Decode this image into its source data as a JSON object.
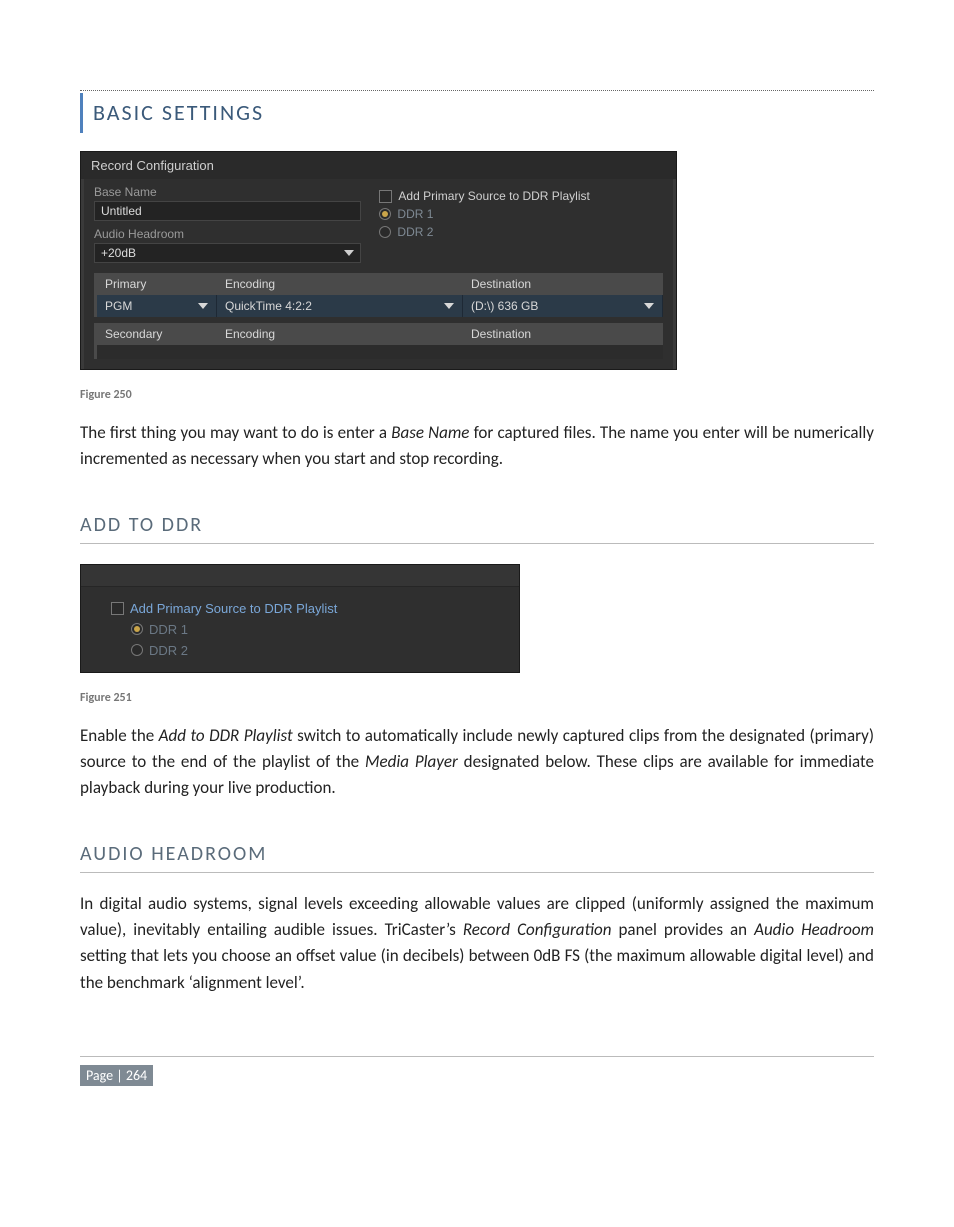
{
  "section_title": "BASIC SETTINGS",
  "fig250_caption": "Figure 250",
  "para1_a": "The first thing you may want to do is enter a ",
  "para1_em1": "Base Name",
  "para1_b": " for captured files.  The name you enter will be numerically incremented as necessary when you start and stop recording.",
  "h2_addtoddr": "ADD TO DDR",
  "fig251_caption": "Figure 251",
  "para2_a": "Enable the ",
  "para2_em1": "Add to DDR Playlist",
  "para2_b": " switch to automatically include newly captured clips from the designated (primary) source to the end of the playlist of the ",
  "para2_em2": "Media Player",
  "para2_c": " designated below. These clips are available for immediate playback during your live production.",
  "h2_audio": "AUDIO HEADROOM",
  "para3_a": "In digital audio systems, signal levels exceeding allowable values are clipped (uniformly assigned the maximum value), inevitably entailing audible issues. TriCaster’s ",
  "para3_em1": "Record Configuration",
  "para3_b": " panel provides an ",
  "para3_em2": "Audio Headroom",
  "para3_c": " setting that lets you choose an offset value (in decibels) between 0dB FS (the maximum allowable digital level) and the benchmark ‘alignment level’.",
  "page_footer": "Page | 264",
  "panel250": {
    "title": "Record Configuration",
    "base_name_label": "Base Name",
    "base_name_value": "Untitled",
    "audio_headroom_label": "Audio Headroom",
    "audio_headroom_value": "+20dB",
    "add_primary_label": "Add Primary Source to DDR Playlist",
    "ddr1_label": "DDR 1",
    "ddr2_label": "DDR 2",
    "col_primary": "Primary",
    "col_encoding": "Encoding",
    "col_destination": "Destination",
    "primary_source": "PGM",
    "primary_encoding": "QuickTime 4:2:2",
    "primary_destination": "(D:\\) 636 GB",
    "col2_secondary": "Secondary"
  },
  "panel251": {
    "add_primary_label": "Add Primary Source to DDR Playlist",
    "ddr1_label": "DDR 1",
    "ddr2_label": "DDR 2"
  }
}
